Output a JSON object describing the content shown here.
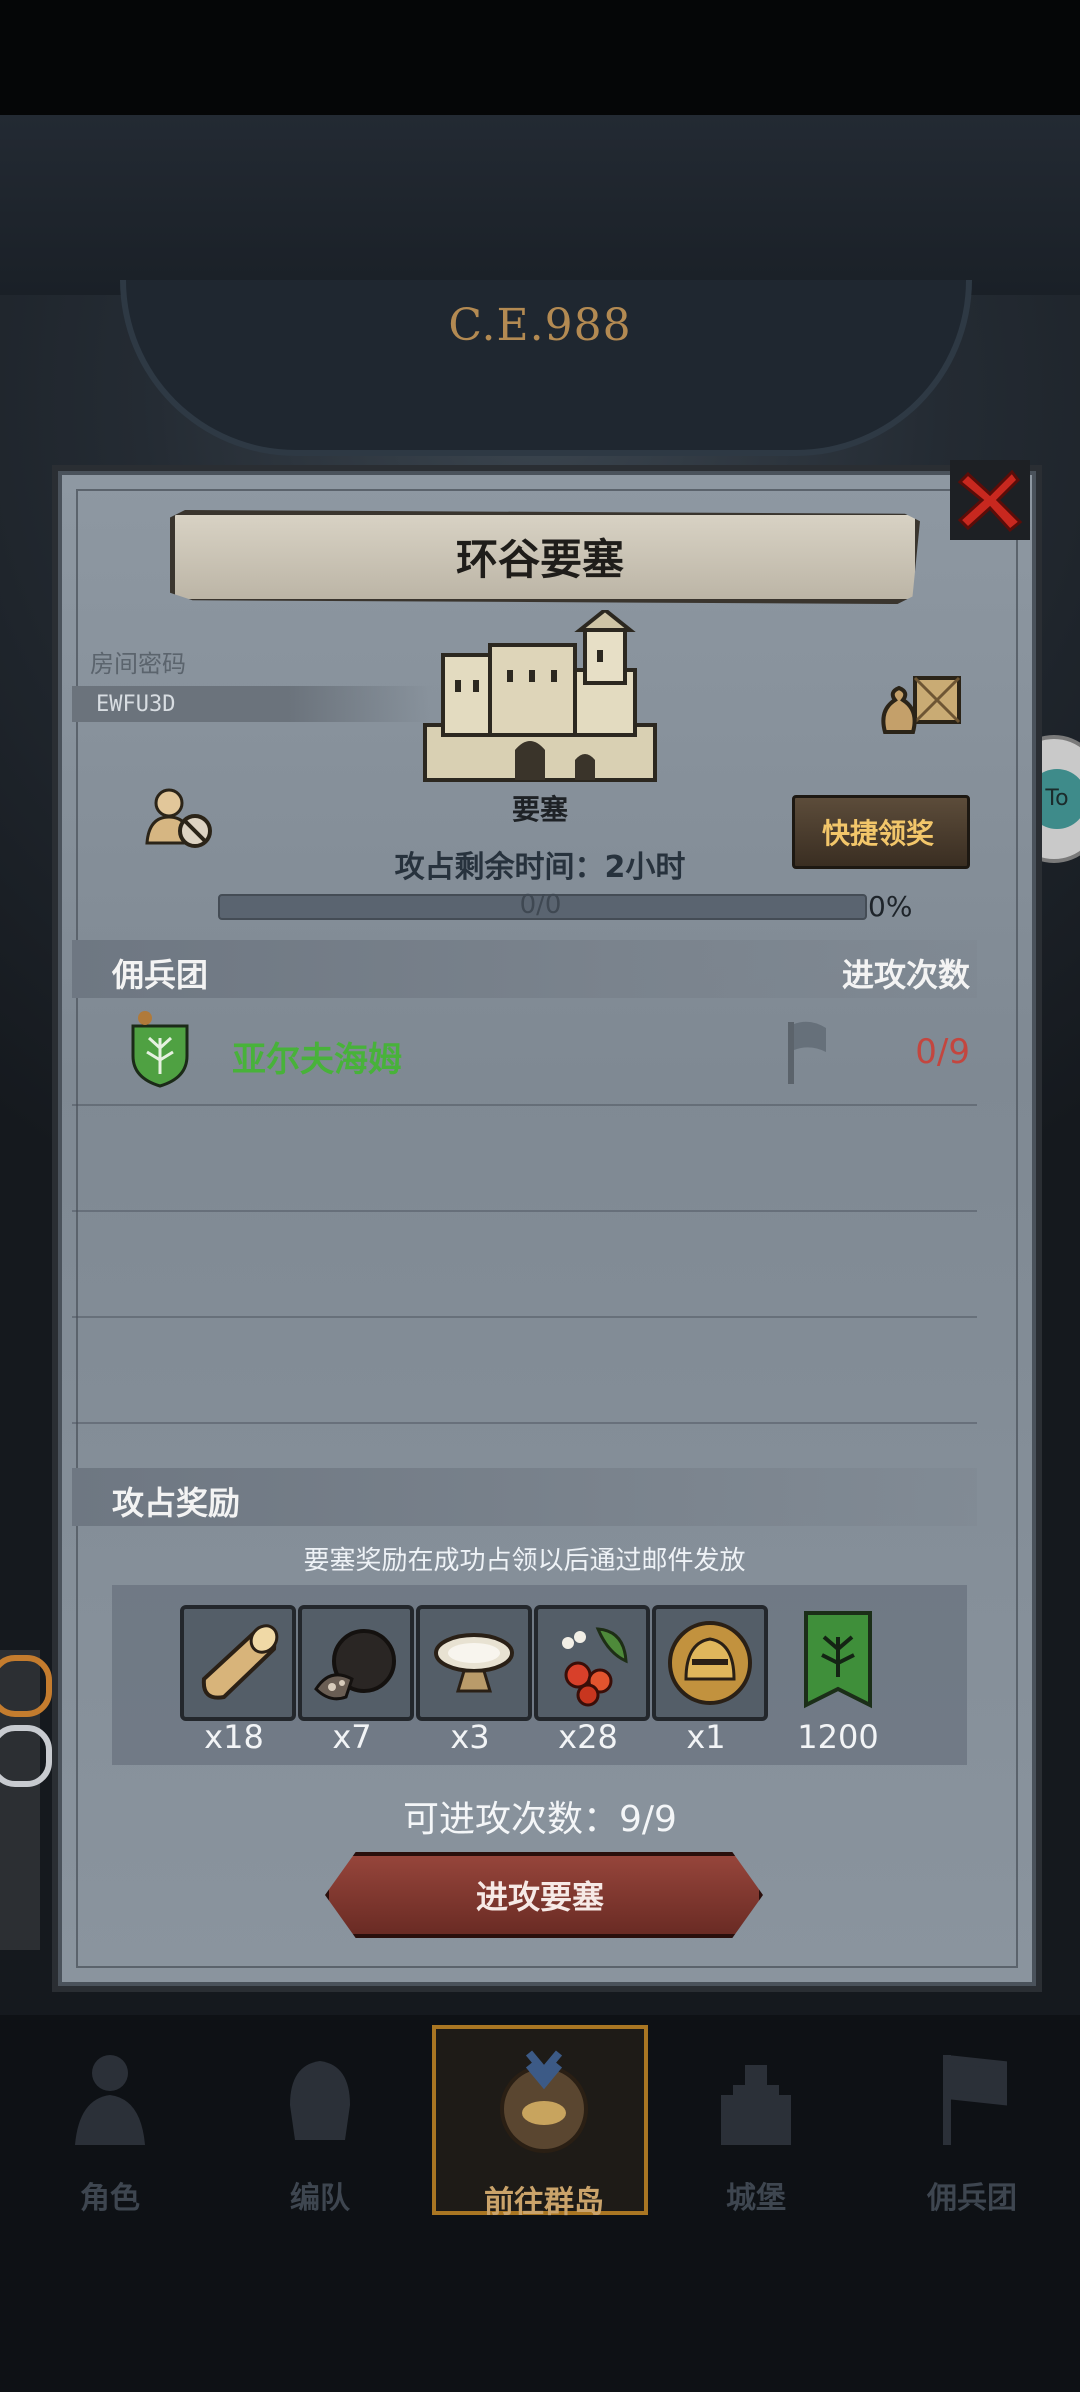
{
  "hud": {
    "era": "C.E.988"
  },
  "dialog": {
    "title": "环谷要塞",
    "room_code_label": "房间密码",
    "room_code": "EWFU3D",
    "fortress_label": "要塞",
    "quick_claim_label": "快捷领奖",
    "time_remaining": "攻占剩余时间：2小时",
    "progress": {
      "text": "0/0",
      "percent_text": "0%",
      "fraction": 0
    },
    "mercenary_header": "佣兵团",
    "attack_count_header": "进攻次数",
    "mercenaries": [
      {
        "name": "亚尔夫海姆",
        "attacks": "0/9",
        "name_color": "#48b23a"
      }
    ],
    "rewards_header": "攻占奖励",
    "rewards_note": "要塞奖励在成功占领以后通过邮件发放",
    "rewards": [
      {
        "icon": "wood-log-icon",
        "qty": "x18"
      },
      {
        "icon": "truffle-icon",
        "qty": "x7"
      },
      {
        "icon": "bowl-icon",
        "qty": "x3"
      },
      {
        "icon": "berries-icon",
        "qty": "x28"
      },
      {
        "icon": "knight-helmet-icon",
        "qty": "x1"
      },
      {
        "icon": "tree-banner-icon",
        "qty": "1200"
      }
    ],
    "available_attacks": "可进攻次数：9/9",
    "attack_button_label": "进攻要塞"
  },
  "nav": {
    "items": [
      {
        "label": "角色",
        "icon": "character-icon"
      },
      {
        "label": "编队",
        "icon": "formation-icon"
      },
      {
        "label": "前往群岛",
        "icon": "archipelago-icon",
        "active": true
      },
      {
        "label": "城堡",
        "icon": "castle-icon"
      },
      {
        "label": "佣兵团",
        "icon": "mercenary-icon"
      }
    ]
  },
  "colors": {
    "accent_gold": "#f2c66a",
    "danger_red": "#c3463f",
    "guild_green": "#48b23a"
  }
}
